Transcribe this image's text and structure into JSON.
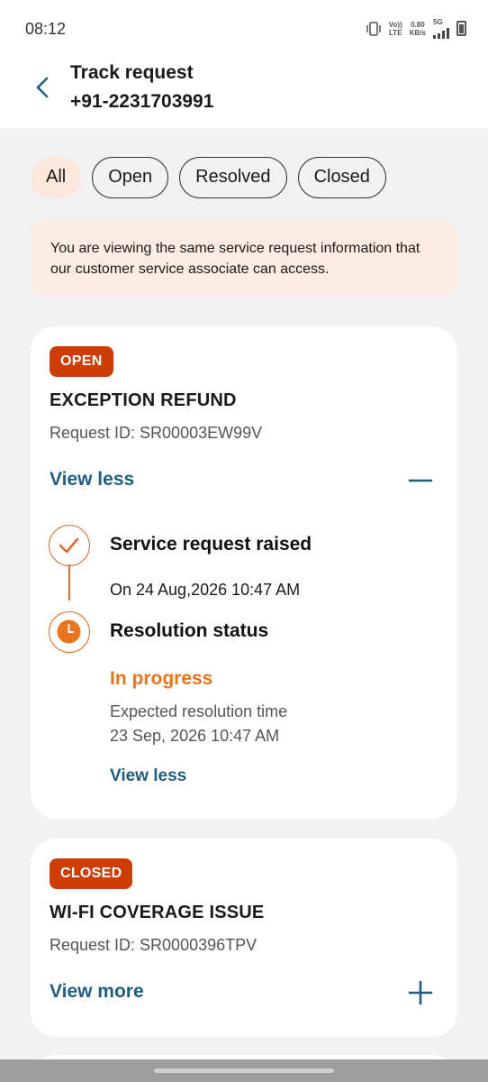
{
  "status_bar": {
    "time": "08:12",
    "volte_top": "Vo))",
    "volte_bottom": "LTE",
    "speed_top": "0.80",
    "speed_bottom": "KB/s",
    "network": "5G"
  },
  "header": {
    "title": "Track request",
    "subtitle": "+91-2231703991",
    "back_icon": "chevron-left-icon"
  },
  "filters": {
    "items": [
      "All",
      "Open",
      "Resolved",
      "Closed"
    ],
    "selected": "All"
  },
  "notice": {
    "text": "You are viewing the same service request information that our customer service associate can access."
  },
  "requests": [
    {
      "status": "OPEN",
      "title": "EXCEPTION REFUND",
      "request_id": "Request ID: SR00003EW99V",
      "toggle_label": "View less",
      "toggle_icon": "minus-icon",
      "timeline": {
        "step1_title": "Service request raised",
        "step1_date": "On 24 Aug,2026 10:47 AM",
        "step2_title": "Resolution status",
        "step2_status": "In progress",
        "expected_label": "Expected resolution time",
        "expected_time": "23 Sep, 2026 10:47 AM",
        "inner_link": "View less"
      }
    },
    {
      "status": "CLOSED",
      "title": "WI-FI COVERAGE ISSUE",
      "request_id": "Request ID: SR0000396TPV",
      "toggle_label": "View more",
      "toggle_icon": "plus-icon"
    }
  ],
  "colors": {
    "badge": "#cc3e06",
    "link": "#1f5e7e",
    "timeline_accent": "#e06b2c",
    "in_progress": "#e8741f",
    "notice_bg": "#fbece2",
    "active_chip": "#fbe7dc"
  }
}
